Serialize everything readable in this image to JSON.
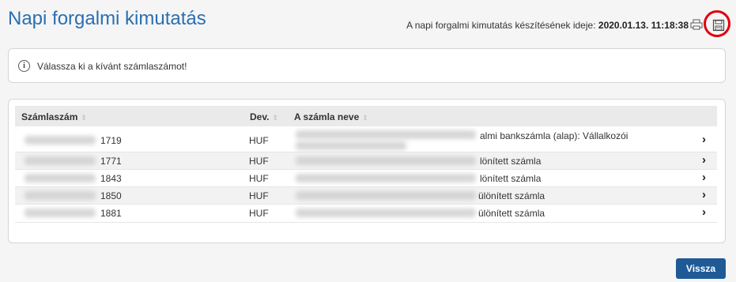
{
  "header": {
    "title": "Napi forgalmi kimutatás",
    "meta_label": "A napi forgalmi kimutatás készítésének ideje:",
    "meta_value": "2020.01.13. 11:18:38",
    "print_icon": "print-icon",
    "save_icon": "save-icon",
    "highlight_color": "#e0000e"
  },
  "alert": {
    "icon": "info-icon",
    "icon_glyph": "i",
    "text": "Válassza ki a kívánt számlaszámot!"
  },
  "table": {
    "columns": [
      "Számlaszám",
      "Dev.",
      "A számla neve"
    ],
    "sort_glyph": "⇕",
    "rows": [
      {
        "account_suffix": "1719",
        "currency": "HUF",
        "name_visible": "almi bankszámla (alap): Vállalkozói"
      },
      {
        "account_suffix": "1771",
        "currency": "HUF",
        "name_visible": "lönített számla"
      },
      {
        "account_suffix": "1843",
        "currency": "HUF",
        "name_visible": "lönített számla"
      },
      {
        "account_suffix": "1850",
        "currency": "HUF",
        "name_visible": "ülönített számla"
      },
      {
        "account_suffix": "1881",
        "currency": "HUF",
        "name_visible": "ülönített számla"
      }
    ],
    "row_action_glyph": "›"
  },
  "footer": {
    "back_label": "Vissza",
    "accent": "#1f5a96"
  }
}
